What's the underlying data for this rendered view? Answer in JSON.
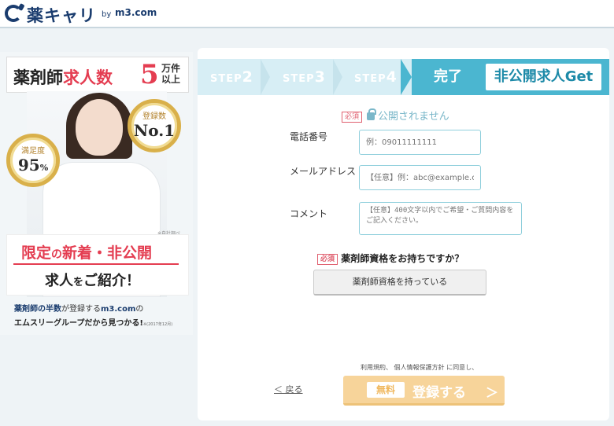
{
  "header": {
    "logo_text": "薬キャリ",
    "logo_by": "by",
    "logo_m3": "m3.com"
  },
  "banner": {
    "title_a": "薬剤師",
    "title_b": "求人数",
    "big_number": "5",
    "unit_1": "万件",
    "unit_2": "以上",
    "medal_1_label": "満足度",
    "medal_1_value": "95",
    "medal_1_unit": "%",
    "medal_2_label": "登録数",
    "medal_2_value": "No.1",
    "survey_note": "※自社調べ",
    "limited_1": "限定",
    "limited_2": "の",
    "limited_3": "新着・非公開",
    "limited_4": "求人",
    "limited_5": "を",
    "limited_6": "ご紹介！",
    "footer_1a": "薬剤師の半数",
    "footer_1b": "が登録する",
    "footer_1c": "m3.com",
    "footer_1d": "の",
    "footer_2": "エムスリーグループだから見つかる!",
    "footer_note": "※(2017年12月)"
  },
  "steps": {
    "step_prefix": "STEP",
    "items": [
      "2",
      "3",
      "4"
    ],
    "done_label": "完了",
    "get_label": "非公開求人Get"
  },
  "form": {
    "required_badge": "必須",
    "privacy_text": "公開されません",
    "phone_label": "電話番号",
    "phone_placeholder": "例：09011111111",
    "email_label": "メールアドレス",
    "email_placeholder": "【任意】例：abc@example.com",
    "comment_label": "コメント",
    "comment_placeholder": "【任意】400文字以内でご希望・ご質問内容をご記入ください。",
    "qualification_question": "薬剤師資格をお持ちですか？",
    "qualification_button": "薬剤師資格を持っている",
    "agree_text": "利用規約、 個人情報保護方針 に同意し、",
    "back_label": "＜ 戻る",
    "free_badge": "無料",
    "submit_label": "登録する",
    "submit_chevron": "＞"
  },
  "colors": {
    "brand_navy": "#1a3c6e",
    "accent_red": "#e43d51",
    "step_active": "#4bb6d0",
    "submit_bg": "#f7d49a"
  }
}
